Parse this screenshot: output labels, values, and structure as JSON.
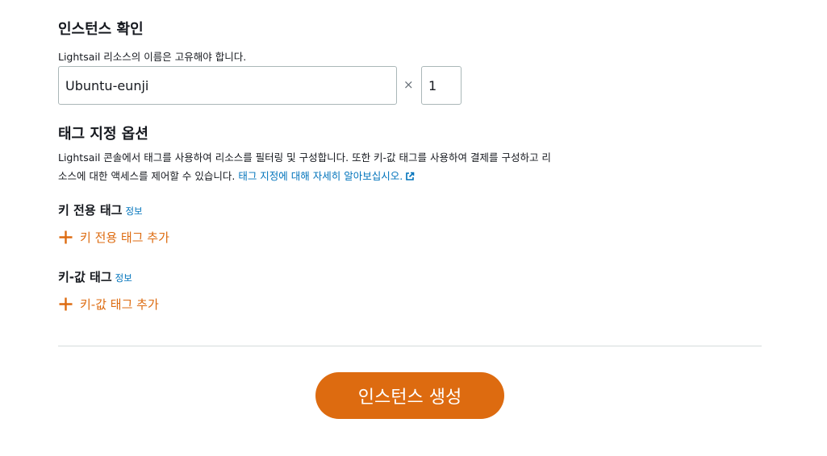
{
  "instance": {
    "title": "인스턴스 확인",
    "hint": "Lightsail 리소스의 이름은 고유해야 합니다.",
    "name_value": "Ubuntu-eunji",
    "multiply_symbol": "×",
    "count_value": "1"
  },
  "tags": {
    "title": "태그 지정 옵션",
    "description_line1": "Lightsail 콘솔에서 태그를 사용하여 리소스를 필터링 및 구성합니다. 또한 키-값 태그를 사용하여 결제를 구성하고 리",
    "description_line2": "소스에 대한 액세스를 제어할 수 있습니다. ",
    "learn_more_link": "태그 지정에 대해 자세히 알아보십시오.",
    "key_only": {
      "heading": "키 전용 태그",
      "info": "정보",
      "add_label": "키 전용 태그 추가"
    },
    "key_value": {
      "heading": "키-값 태그",
      "info": "정보",
      "add_label": "키-값 태그 추가"
    }
  },
  "footer": {
    "create_button": "인스턴스 생성"
  },
  "colors": {
    "accent": "#dd6b10",
    "link": "#0073bb",
    "text": "#16191f",
    "divider": "#d5dbdb"
  }
}
